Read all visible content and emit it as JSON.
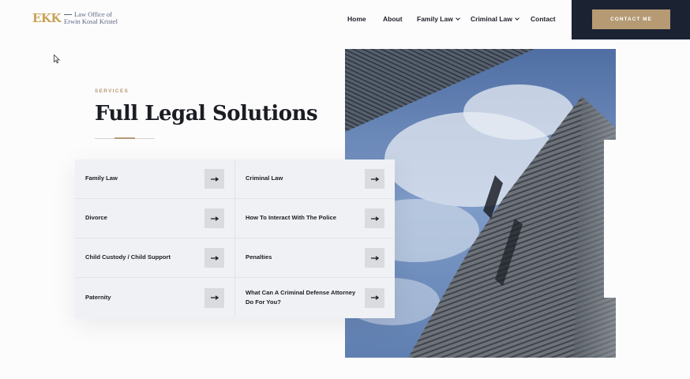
{
  "logo": {
    "mark": "EKK",
    "line1": "Law Office of",
    "line2": "Erwin Kosal Kristel"
  },
  "nav": {
    "items": [
      {
        "label": "Home",
        "dropdown": false
      },
      {
        "label": "About",
        "dropdown": false
      },
      {
        "label": "Family Law",
        "dropdown": true
      },
      {
        "label": "Criminal Law",
        "dropdown": true
      },
      {
        "label": "Contact",
        "dropdown": false
      }
    ],
    "cta": "CONTACT ME"
  },
  "section": {
    "eyebrow": "SERVICES",
    "title": "Full Legal Solutions"
  },
  "services": {
    "left": [
      {
        "label": "Family Law"
      },
      {
        "label": "Divorce"
      },
      {
        "label": "Child Custody / Child Support"
      },
      {
        "label": "Paternity"
      }
    ],
    "right": [
      {
        "label": "Criminal Law"
      },
      {
        "label": "How To Interact With The Police"
      },
      {
        "label": "Penalties"
      },
      {
        "label": "What Can A Criminal Defense Attorney Do For You?"
      }
    ]
  },
  "colors": {
    "accent": "#b59a74",
    "dark": "#1b2232",
    "logo_gold": "#c8a255"
  },
  "icons": {
    "arrow": "arrow-right-icon",
    "chevron": "chevron-down-icon",
    "cursor": "mouse-cursor-icon"
  },
  "photo": {
    "subject": "building-photo"
  }
}
